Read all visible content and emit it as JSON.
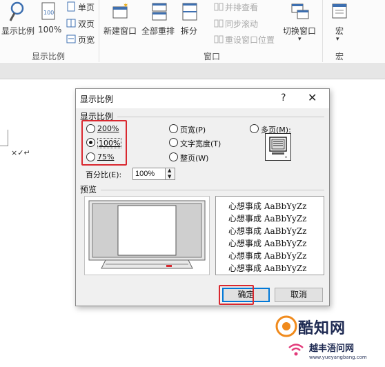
{
  "ribbon": {
    "zoom_group": {
      "zoom_button": "显示比例",
      "hundred_button": "100%",
      "one_page": "单页",
      "two_pages": "双页",
      "page_width": "页宽",
      "group_label": "显示比例"
    },
    "window_group": {
      "new_window": "新建窗口",
      "arrange_all": "全部重排",
      "split": "拆分",
      "view_side_by_side": "并排查看",
      "sync_scroll": "同步滚动",
      "reset_window_pos": "重设窗口位置",
      "switch_windows": "切换窗口",
      "group_label": "窗口"
    },
    "macro_group": {
      "macros": "宏",
      "group_label": "宏"
    }
  },
  "document": {
    "mark_text": "×✓↵"
  },
  "dialog": {
    "title": "显示比例",
    "help": "?",
    "close": "✕",
    "zoom_section_label": "显示比例",
    "options": {
      "opt_200": "200%",
      "opt_100": "100%",
      "opt_75": "75%",
      "page_width": "页宽(P)",
      "text_width": "文字宽度(T)",
      "whole_page": "整页(W)",
      "many_pages": "多页(M):"
    },
    "selected": "100%",
    "percent_label": "百分比(E):",
    "percent_value": "100%",
    "preview_label": "预览",
    "sample_text": "心想事成 AaBbYyZz",
    "sample_lines": [
      "心想事成 AaBbYyZz",
      "心想事成 AaBbYyZz",
      "心想事成 AaBbYyZz",
      "心想事成 AaBbYyZz",
      "心想事成 AaBbYyZz",
      "心想事成 AaBbYyZz"
    ],
    "ok": "确定",
    "cancel": "取消"
  },
  "watermark": {
    "brand": "酷知网",
    "sub": "越丰浯问网",
    "url": "www.yueyangbang.com"
  },
  "colors": {
    "highlight_red": "#d9282f",
    "focus_blue": "#0078d7",
    "watermark_navy": "#1e2a52"
  }
}
